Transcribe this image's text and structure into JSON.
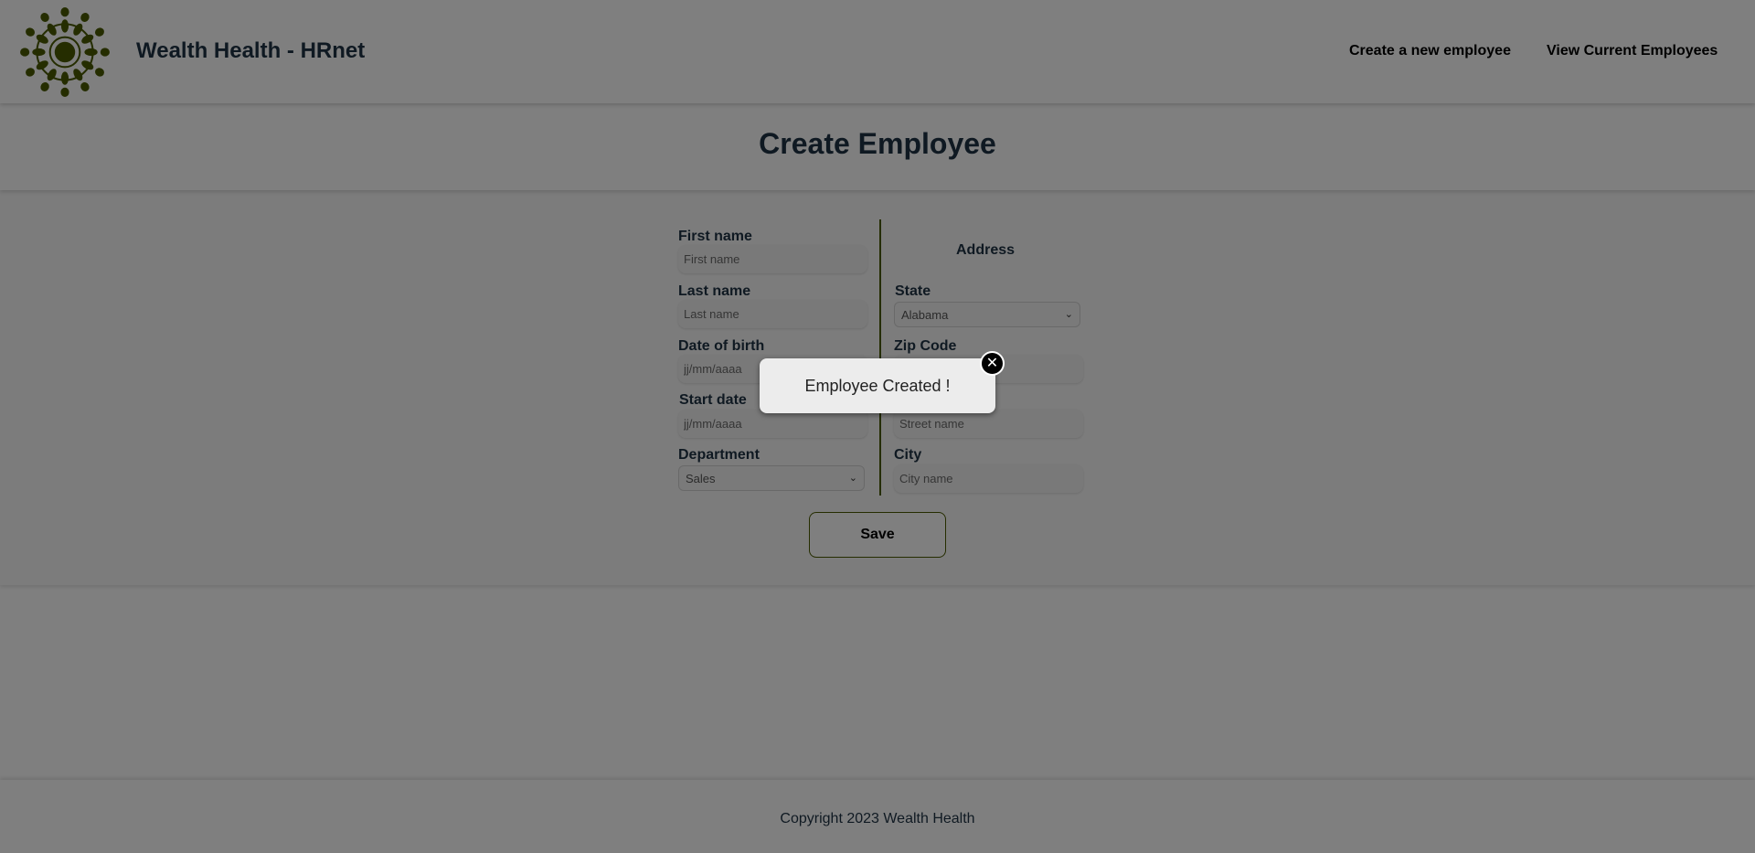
{
  "header": {
    "brand": "Wealth Health - HRnet",
    "logo_icon": "sunburst-logo-icon",
    "logo_color": "#4a5a00",
    "nav": {
      "create": "Create a new employee",
      "view": "View Current Employees"
    }
  },
  "page": {
    "title": "Create Employee"
  },
  "form": {
    "first_name": {
      "label": "First name",
      "placeholder": "First name",
      "value": ""
    },
    "last_name": {
      "label": "Last name",
      "placeholder": "Last name",
      "value": ""
    },
    "date_of_birth": {
      "label": "Date of birth",
      "placeholder": "jj/mm/aaaa",
      "value": ""
    },
    "start_date": {
      "label": "Start date",
      "placeholder": "jj/mm/aaaa",
      "value": ""
    },
    "department": {
      "label": "Department",
      "selected": "Sales"
    },
    "address": {
      "title": "Address",
      "state": {
        "label": "State",
        "selected": "Alabama"
      },
      "zip": {
        "label": "Zip Code",
        "placeholder": "",
        "value": ""
      },
      "street": {
        "label": "",
        "placeholder": "Street name",
        "value": ""
      },
      "city": {
        "label": "City",
        "placeholder": "City name",
        "value": ""
      }
    },
    "save_label": "Save"
  },
  "footer": {
    "copyright": "Copyright 2023 Wealth Health"
  },
  "modal": {
    "message": "Employee Created !",
    "close_glyph": "✕",
    "close_icon": "close-icon"
  },
  "colors": {
    "accent": "#4a5a00",
    "heading": "#1f3344",
    "overlay": "rgba(0,0,0,0.5)"
  }
}
